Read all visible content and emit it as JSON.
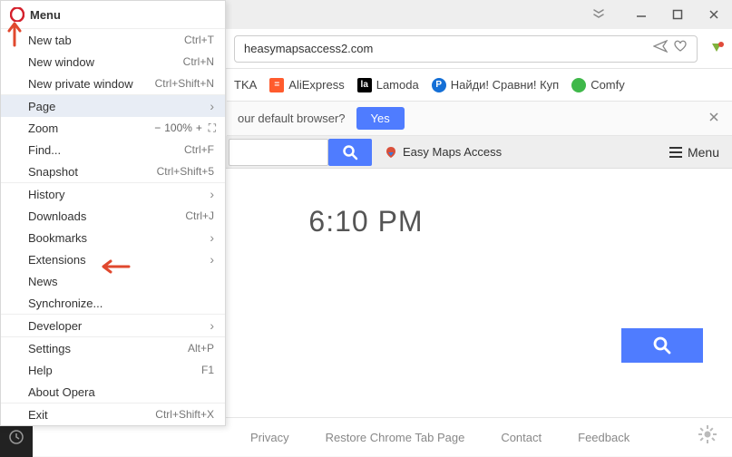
{
  "window": {
    "minimize_icon": "minimize",
    "maximize_icon": "maximize",
    "close_icon": "close"
  },
  "address": {
    "url": "heasymapsaccess2.com",
    "send_icon": "send",
    "heart_icon": "heart"
  },
  "bookmarks": {
    "items": [
      {
        "label": "TKA",
        "color": "#2a2a2a"
      },
      {
        "label": "AliExpress",
        "color": "#ff5b2d",
        "glyph": "="
      },
      {
        "label": "Lamoda",
        "color": "#000000",
        "glyph": "la"
      },
      {
        "label": "Найди! Сравни! Куп",
        "color": "#146fd6",
        "glyph": "P"
      },
      {
        "label": "Comfy",
        "color": "#3fb84a"
      }
    ]
  },
  "banner": {
    "text": "our default browser?",
    "yes": "Yes"
  },
  "page": {
    "search_btn_icon": "search",
    "ema_label": "Easy Maps Access",
    "menu_btn": "Menu",
    "clock": "6:10 PM"
  },
  "footer": {
    "links": [
      "Privacy",
      "Restore Chrome Tab Page",
      "Contact",
      "Feedback"
    ]
  },
  "menu": {
    "title": "Menu",
    "items": [
      {
        "label": "New tab",
        "shortcut": "Ctrl+T"
      },
      {
        "label": "New window",
        "shortcut": "Ctrl+N"
      },
      {
        "label": "New private window",
        "shortcut": "Ctrl+Shift+N"
      }
    ],
    "page_item": {
      "label": "Page",
      "sub": true,
      "hover": true
    },
    "zoom": {
      "label": "Zoom",
      "value": "100%"
    },
    "find": {
      "label": "Find...",
      "shortcut": "Ctrl+F"
    },
    "snapshot": {
      "label": "Snapshot",
      "shortcut": "Ctrl+Shift+5"
    },
    "history": {
      "label": "History",
      "sub": true
    },
    "downloads": {
      "label": "Downloads",
      "shortcut": "Ctrl+J"
    },
    "bookmarks": {
      "label": "Bookmarks",
      "sub": true
    },
    "extensions": {
      "label": "Extensions",
      "sub": true
    },
    "news": {
      "label": "News"
    },
    "synchronize": {
      "label": "Synchronize..."
    },
    "developer": {
      "label": "Developer",
      "sub": true
    },
    "settings": {
      "label": "Settings",
      "shortcut": "Alt+P"
    },
    "help": {
      "label": "Help",
      "shortcut": "F1"
    },
    "about": {
      "label": "About Opera"
    },
    "exit": {
      "label": "Exit",
      "shortcut": "Ctrl+Shift+X"
    }
  }
}
